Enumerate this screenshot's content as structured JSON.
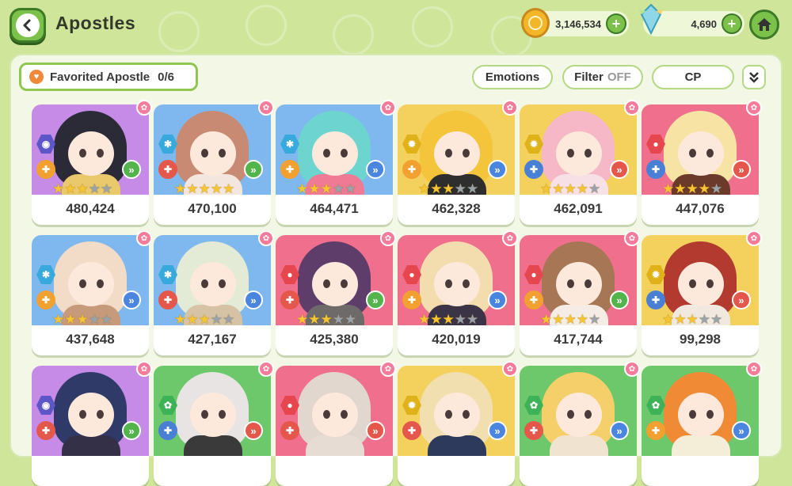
{
  "header": {
    "title": "Apostles",
    "gold": "3,146,534",
    "crystals": "4,690",
    "back_icon": "back-arrow-icon",
    "home_icon": "home-icon"
  },
  "toolbar": {
    "favorite_label": "Favorited Apostle",
    "favorite_count": "0/6",
    "emotions_label": "Emotions",
    "filter_label": "Filter",
    "filter_state": "OFF",
    "sort_label": "CP",
    "expand_icon": "double-chevron-down-icon"
  },
  "colors": {
    "purple": "#c58be6",
    "blue": "#7fb8ee",
    "yellow": "#f3d15c",
    "pink": "#f06f8c",
    "green": "#6cc86a"
  },
  "apostles": [
    {
      "cp": "480,424",
      "bg": "purple",
      "stars": 3,
      "element": "#5d56c9",
      "role": "#f2a030",
      "pos": "#52b44a",
      "hair": "#2b2b38",
      "outfit": "#e9c96b"
    },
    {
      "cp": "470,100",
      "bg": "blue",
      "stars": 5,
      "element": "#38a9dc",
      "role": "#e6574b",
      "pos": "#52b44a",
      "hair": "#c98a74",
      "outfit": "#f3e6df"
    },
    {
      "cp": "464,471",
      "bg": "blue",
      "stars": 3,
      "element": "#38a9dc",
      "role": "#f2a030",
      "pos": "#4a86e0",
      "hair": "#6dd4d0",
      "outfit": "#f07a94"
    },
    {
      "cp": "462,328",
      "bg": "yellow",
      "stars": 3,
      "element": "#e0b21a",
      "role": "#f2a030",
      "pos": "#4a86e0",
      "hair": "#f4c43a",
      "outfit": "#2e2e2e"
    },
    {
      "cp": "462,091",
      "bg": "yellow",
      "stars": 4,
      "element": "#e0b21a",
      "role": "#4a7fd6",
      "pos": "#e6574b",
      "hair": "#f6b7c6",
      "outfit": "#f7e1e6"
    },
    {
      "cp": "447,076",
      "bg": "pink",
      "stars": 4,
      "element": "#e6474f",
      "role": "#4a7fd6",
      "pos": "#e6574b",
      "hair": "#f7e3a4",
      "outfit": "#6b3a2a"
    },
    {
      "cp": "437,648",
      "bg": "blue",
      "stars": 3,
      "element": "#38a9dc",
      "role": "#f2a030",
      "pos": "#4a86e0",
      "hair": "#f2dcc7",
      "outfit": "#c79a7b"
    },
    {
      "cp": "427,167",
      "bg": "blue",
      "stars": 3,
      "element": "#38a9dc",
      "role": "#e6574b",
      "pos": "#4a86e0",
      "hair": "#e3ead6",
      "outfit": "#d6c3a5"
    },
    {
      "cp": "425,380",
      "bg": "pink",
      "stars": 3,
      "element": "#e6474f",
      "role": "#e6574b",
      "pos": "#52b44a",
      "hair": "#5e3d6b",
      "outfit": "#6e6a6a"
    },
    {
      "cp": "420,019",
      "bg": "pink",
      "stars": 3,
      "element": "#e6474f",
      "role": "#f2a030",
      "pos": "#4a86e0",
      "hair": "#f3dcae",
      "outfit": "#3b3446"
    },
    {
      "cp": "417,744",
      "bg": "pink",
      "stars": 4,
      "element": "#e6474f",
      "role": "#f2a030",
      "pos": "#52b44a",
      "hair": "#a67655",
      "outfit": "#f5ece5"
    },
    {
      "cp": "99,298",
      "bg": "yellow",
      "stars": 3,
      "element": "#e0b21a",
      "role": "#4a7fd6",
      "pos": "#e6574b",
      "hair": "#b23a2f",
      "outfit": "#f1e9df"
    },
    {
      "cp": "",
      "bg": "purple",
      "stars": 0,
      "element": "#5d56c9",
      "role": "#e6574b",
      "pos": "#52b44a",
      "hair": "#2f3a68",
      "outfit": "#343048"
    },
    {
      "cp": "",
      "bg": "green",
      "stars": 0,
      "element": "#3db257",
      "role": "#4a7fd6",
      "pos": "#e6574b",
      "hair": "#e8e4e4",
      "outfit": "#3a3a3a"
    },
    {
      "cp": "",
      "bg": "pink",
      "stars": 0,
      "element": "#e6474f",
      "role": "#e6574b",
      "pos": "#e6574b",
      "hair": "#e2d7cf",
      "outfit": "#e7dcd3"
    },
    {
      "cp": "",
      "bg": "yellow",
      "stars": 0,
      "element": "#e0b21a",
      "role": "#e6574b",
      "pos": "#4a86e0",
      "hair": "#f2dfb0",
      "outfit": "#2d3a5c"
    },
    {
      "cp": "",
      "bg": "green",
      "stars": 0,
      "element": "#3db257",
      "role": "#e6574b",
      "pos": "#4a86e0",
      "hair": "#f4cf6a",
      "outfit": "#f0e4d0"
    },
    {
      "cp": "",
      "bg": "green",
      "stars": 0,
      "element": "#3db257",
      "role": "#f2a030",
      "pos": "#4a86e0",
      "hair": "#f08a34",
      "outfit": "#f4eed8"
    }
  ]
}
